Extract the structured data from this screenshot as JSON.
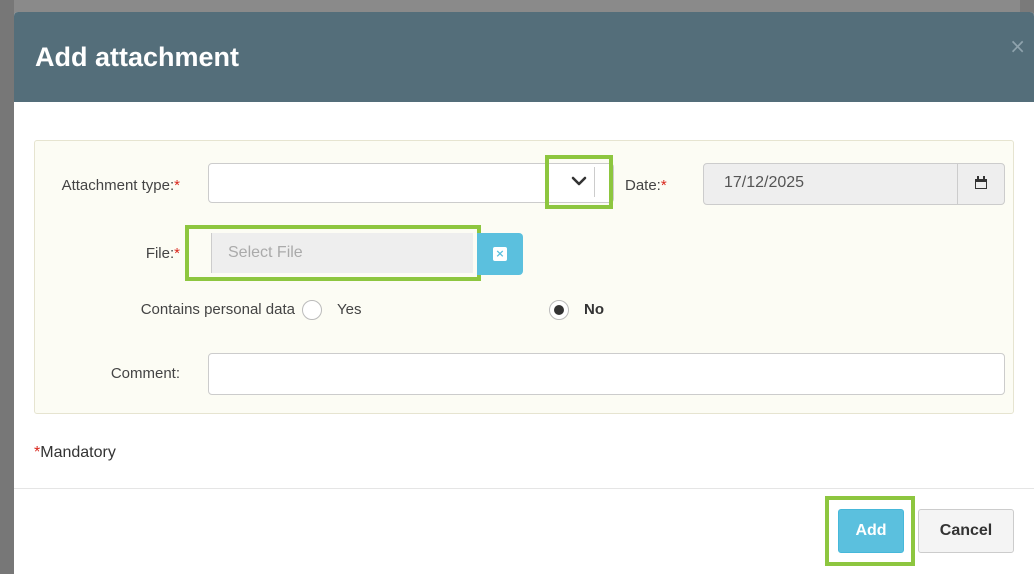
{
  "dialog": {
    "title": "Add attachment",
    "close_icon": "×"
  },
  "form": {
    "attachment_type": {
      "label": "Attachment type:",
      "required_mark": "*",
      "value": "",
      "dropdown_icon": "chevron-down-icon"
    },
    "date": {
      "label": "Date:",
      "required_mark": "*",
      "value": "17/12/2025",
      "button_icon": "calendar-icon"
    },
    "file": {
      "label": "File:",
      "required_mark": "*",
      "placeholder": "Select File",
      "clear_icon": "×"
    },
    "personal_data": {
      "label": "Contains personal data",
      "options": [
        {
          "label": "Yes",
          "selected": false
        },
        {
          "label": "No",
          "selected": true
        }
      ]
    },
    "comment": {
      "label": "Comment:",
      "value": ""
    }
  },
  "mandatory_note": {
    "mark": "*",
    "text": "Mandatory"
  },
  "footer": {
    "add_label": "Add",
    "cancel_label": "Cancel"
  },
  "colors": {
    "header_bg": "#546e7a",
    "highlight": "#8dc63f",
    "primary_btn": "#5bc0de",
    "required": "#d9261c"
  }
}
